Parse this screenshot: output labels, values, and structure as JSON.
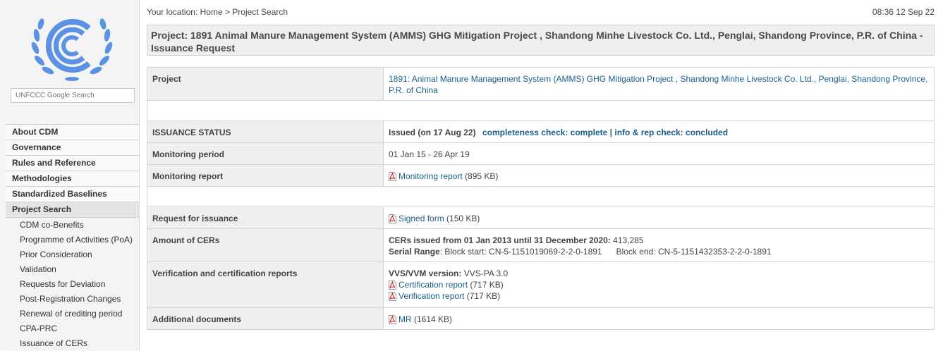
{
  "sidebar": {
    "search_placeholder": "UNFCCC Google Search",
    "nav": [
      {
        "label": "About CDM"
      },
      {
        "label": "Governance"
      },
      {
        "label": "Rules and Reference"
      },
      {
        "label": "Methodologies"
      },
      {
        "label": "Standardized Baselines"
      },
      {
        "label": "Project Search"
      }
    ],
    "sub": [
      {
        "label": "CDM co-Benefits"
      },
      {
        "label": "Programme of Activities (PoA)"
      },
      {
        "label": "Prior Consideration"
      },
      {
        "label": "Validation"
      },
      {
        "label": "Requests for Deviation"
      },
      {
        "label": "Post-Registration Changes"
      },
      {
        "label": "Renewal of crediting period"
      },
      {
        "label": "CPA-PRC"
      },
      {
        "label": "Issuance of CERs"
      }
    ]
  },
  "header": {
    "breadcrumb": "Your location: Home > Project Search",
    "timestamp": "08:36 12 Sep 22",
    "title": "Project: 1891 Animal Manure Management System (AMMS) GHG Mitigation Project , Shandong Minhe Livestock Co. Ltd., Penglai, Shandong Province, P.R. of China - Issuance Request"
  },
  "table": {
    "project_label": "Project",
    "project_value": "1891: Animal Manure Management System (AMMS) GHG Mitigation Project , Shandong Minhe Livestock Co. Ltd., Penglai, Shandong Province, P.R. of China",
    "status_label": "ISSUANCE STATUS",
    "status_value": "Issued (on 17 Aug 22)",
    "status_links": "completeness check: complete | info & rep check: concluded",
    "monitoring_period_label": "Monitoring period",
    "monitoring_period_value": "01 Jan 15 - 26 Apr 19",
    "monitoring_report_label": "Monitoring report",
    "monitoring_report_link": "Monitoring report",
    "monitoring_report_size": "(895 KB)",
    "request_label": "Request for issuance",
    "request_link": "Signed form",
    "request_size": "(150 KB)",
    "amount_label": "Amount of CERs",
    "amount_line1_bold": "CERs issued from 01 Jan 2013 until 31 December 2020:",
    "amount_line1_value": "413,285",
    "serial_label": "Serial Range",
    "serial_start": ": Block start: CN-5-1151019069-2-2-0-1891",
    "serial_end": "Block end: CN-5-1151432353-2-2-0-1891",
    "verification_label": "Verification and certification reports",
    "vvs_label": "VVS/VVM version:",
    "vvs_value": "VVS-PA 3.0",
    "cert_link": "Certification report",
    "cert_size": "(717 KB)",
    "verif_link": "Verification report",
    "verif_size": "(717 KB)",
    "additional_label": "Additional documents",
    "additional_link": "MR",
    "additional_size": "(1614 KB)"
  },
  "icons": {
    "logo": "unfccc-logo",
    "pdf": "pdf-icon"
  },
  "colors": {
    "link": "#1a5e8a",
    "logo_blue": "#5b92e5",
    "pdf_red": "#cc2222"
  }
}
